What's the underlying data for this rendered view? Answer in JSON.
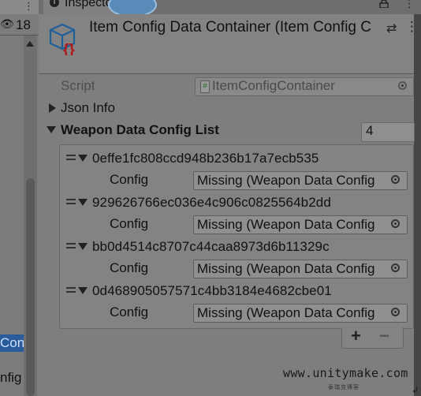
{
  "hierarchy": {
    "visibility_count": "18",
    "selected_item": "Conf",
    "item2": "nfig"
  },
  "inspector": {
    "tab_label": "Inspector",
    "title": "Item Config Data Container (Item Config C",
    "script": {
      "label": "Script",
      "value": "ItemConfigContainer"
    },
    "json_info": {
      "label": "Json Info"
    },
    "weapon_list": {
      "label": "Weapon Data Config List",
      "size": "4",
      "elements": [
        {
          "id": "0effe1fc808ccd948b236b17a7ecb535",
          "config_label": "Config",
          "config_value": "Missing (Weapon Data Config"
        },
        {
          "id": "929626766ec036e4c906c0825564b2dd",
          "config_label": "Config",
          "config_value": "Missing (Weapon Data Config"
        },
        {
          "id": "bb0d4514c8707c44caa8973d6b11329c",
          "config_label": "Config",
          "config_value": "Missing (Weapon Data Config"
        },
        {
          "id": "0d468905057571c4bb3184e4682cbe01",
          "config_label": "Config",
          "config_value": "Missing (Weapon Data Config"
        }
      ],
      "add_label": "+",
      "remove_label": "−"
    }
  },
  "watermark": {
    "main": "www.unitymake.com",
    "sub": "泰瑞克博客"
  },
  "icons": [
    "info-icon",
    "lock-icon",
    "menu-dots-icon",
    "eye-hidden-icon",
    "scroll-up-icon",
    "script-asset-icon",
    "help-icon",
    "settings-icon",
    "object-picker-icon",
    "foldout-arrow-icon",
    "drag-handle-icon"
  ],
  "colors": {
    "panel_bg": "#7e7e7e",
    "selection": "#2a5b9a",
    "icon_blue": "#1f5f9a",
    "icon_red": "#b01818"
  }
}
